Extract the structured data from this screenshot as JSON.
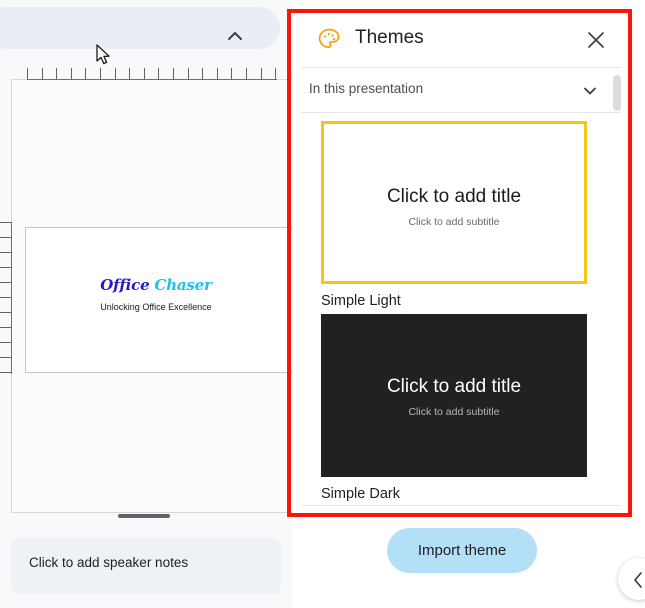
{
  "editor": {
    "toolbar": {
      "collapse_icon": "chevron-up-icon"
    },
    "slide": {
      "title_word1": "Office",
      "title_word2": "Chaser",
      "subtitle": "Unlocking Office Excellence",
      "title_color_1": "#2a1ac6",
      "title_color_2": "#1ec0ef"
    },
    "notes": {
      "placeholder": "Click to add speaker notes"
    },
    "cursor_icon": "mouse-pointer-icon"
  },
  "themes_panel": {
    "icon": "palette-icon",
    "title": "Themes",
    "close_icon": "close-icon",
    "source": {
      "selected": "In this presentation",
      "chevron_icon": "chevron-down-icon"
    },
    "items": [
      {
        "name": "Simple Light",
        "title_placeholder": "Click to add title",
        "subtitle_placeholder": "Click to add subtitle",
        "variant": "light",
        "selected": true
      },
      {
        "name": "Simple Dark",
        "title_placeholder": "Click to add title",
        "subtitle_placeholder": "Click to add subtitle",
        "variant": "dark",
        "selected": false
      }
    ],
    "import_label": "Import theme",
    "accent_selected": "#f5c518",
    "import_bg": "#b3e0f7",
    "highlight_color": "#fb1508"
  },
  "edge_button": {
    "icon": "chevron-left-icon"
  }
}
